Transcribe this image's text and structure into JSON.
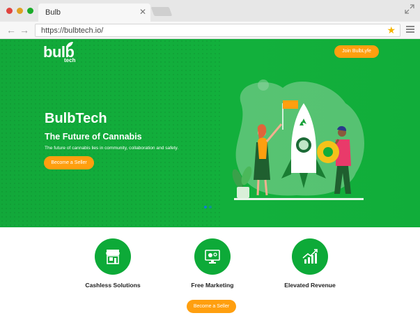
{
  "browser": {
    "tab_title": "Bulb",
    "tab_close": "✕",
    "url": "https://bulbtech.io/"
  },
  "header": {
    "logo_text": "bulb",
    "logo_subtext": "tech",
    "join_button": "Join BulbLyfe"
  },
  "hero": {
    "title": "BulbTech",
    "subtitle": "The Future of Cannabis",
    "description": "The future of cannabis lies in community, collaboration and safety.",
    "cta": "Become a Seller"
  },
  "features": [
    {
      "label": "Cashless Solutions",
      "icon": "storefront-icon"
    },
    {
      "label": "Free Marketing",
      "icon": "marketing-monitor-icon"
    },
    {
      "label": "Elevated Revenue",
      "icon": "growth-chart-icon"
    }
  ],
  "footer_cta": "Become a Seller",
  "colors": {
    "brand_green": "#12ad3a",
    "accent_orange": "#ff9f0f"
  }
}
